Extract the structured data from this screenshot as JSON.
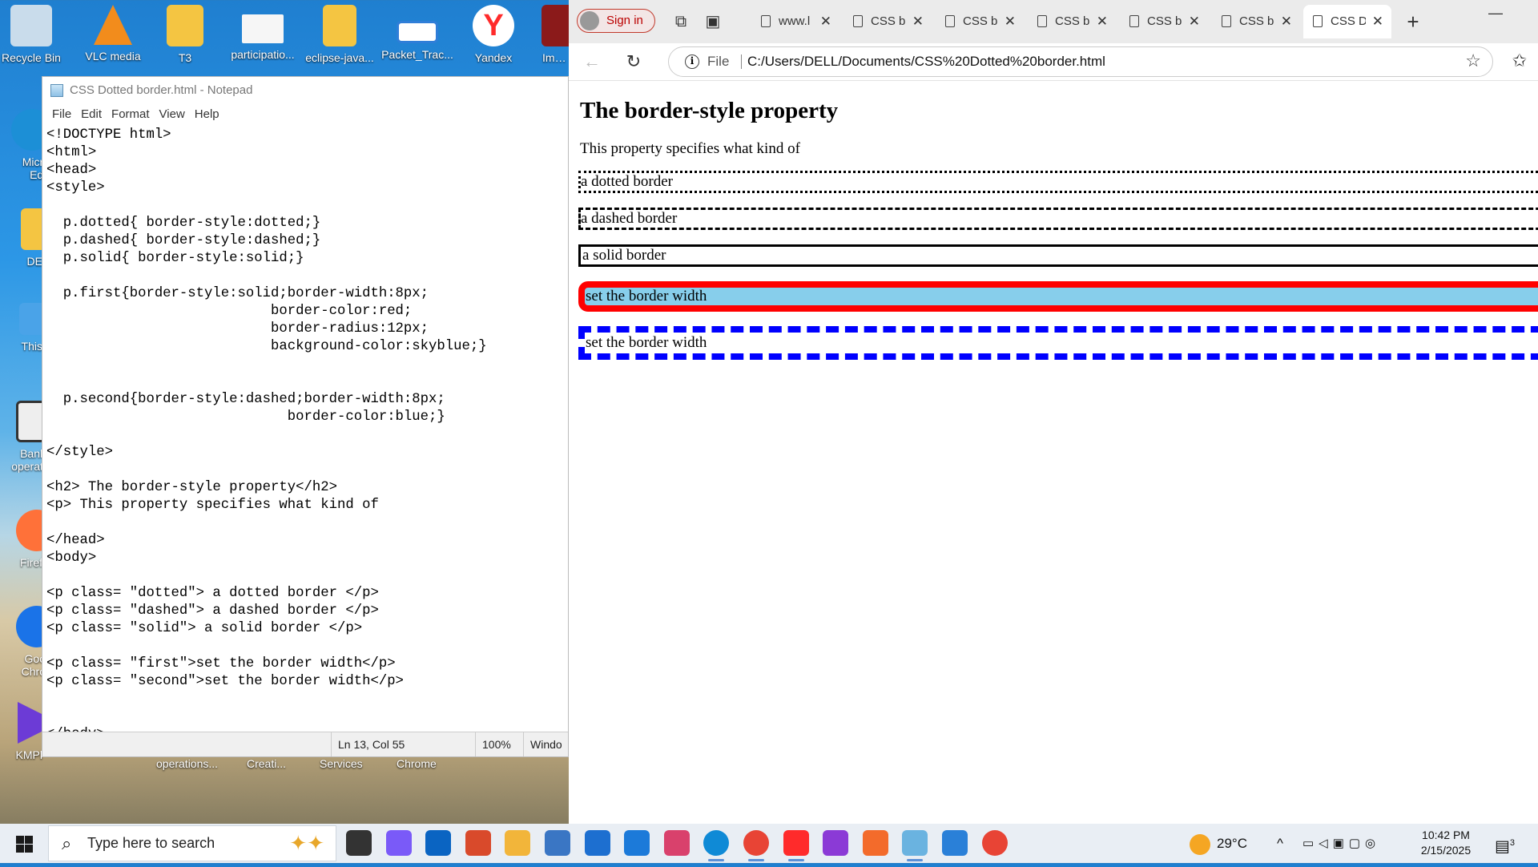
{
  "desktop": {
    "top_icons": [
      {
        "label": "Recycle Bin",
        "color": "#b9d4e8"
      },
      {
        "label": "VLC media",
        "color": "#f28c1c"
      },
      {
        "label": "T3",
        "color": "#f4c542"
      },
      {
        "label": "participatio...",
        "color": "#f2f2f2"
      },
      {
        "label": "eclipse-java...",
        "color": "#f4c542"
      },
      {
        "label": "Packet_Trac...",
        "color": "#2f7ed8"
      },
      {
        "label": "Yandex",
        "color": "#ffffff"
      },
      {
        "label": "Impo",
        "color": "#8b1a1a"
      }
    ],
    "left_icons": [
      {
        "label": "Micro Edg",
        "color": "#1c8fd6"
      },
      {
        "label": "DE",
        "color": "#f4c542"
      },
      {
        "label": "This",
        "color": "#4aa3e8"
      },
      {
        "label": "Bank operati",
        "color": "#eeeeee"
      },
      {
        "label": "Firef",
        "color": "#ff7139"
      },
      {
        "label": "Goo Chro",
        "color": "#1a73e8"
      },
      {
        "label": "KMPl",
        "color": "#6c3bd6"
      }
    ],
    "bottom_labels": [
      "operations...",
      "Creati...",
      "Services",
      "Chrome"
    ]
  },
  "notepad": {
    "title": "CSS Dotted border.html - Notepad",
    "menu": [
      "File",
      "Edit",
      "Format",
      "View",
      "Help"
    ],
    "code": "<!DOCTYPE html>\n<html>\n<head>\n<style>\n\n  p.dotted{ border-style:dotted;}\n  p.dashed{ border-style:dashed;}\n  p.solid{ border-style:solid;}\n\n  p.first{border-style:solid;border-width:8px;\n                           border-color:red;\n                           border-radius:12px;\n                           background-color:skyblue;}\n\n\n  p.second{border-style:dashed;border-width:8px;\n                             border-color:blue;}\n\n</style>\n\n<h2> The border-style property</h2>\n<p> This property specifies what kind of\n\n</head>\n<body>\n\n<p class= \"dotted\"> a dotted border </p>\n<p class= \"dashed\"> a dashed border </p>\n<p class= \"solid\"> a solid border </p>\n\n<p class= \"first\">set the border width</p>\n<p class= \"second\">set the border width</p>\n\n\n</body>",
    "status": {
      "position": "Ln 13, Col 55",
      "zoom": "100%",
      "eol": "Windo"
    }
  },
  "browser": {
    "signin": "Sign in",
    "tabs": [
      {
        "title": "www.l",
        "active": false
      },
      {
        "title": "CSS b",
        "active": false
      },
      {
        "title": "CSS b",
        "active": false
      },
      {
        "title": "CSS b",
        "active": false
      },
      {
        "title": "CSS b",
        "active": false
      },
      {
        "title": "CSS b",
        "active": false
      },
      {
        "title": "CSS D",
        "active": true
      }
    ],
    "new_tab": "+",
    "minimize": "—",
    "address": {
      "scheme": "File",
      "url": "C:/Users/DELL/Documents/CSS%20Dotted%20border.html"
    },
    "page": {
      "heading": "The border-style property",
      "intro": "This property specifies what kind of",
      "dotted": "a dotted border",
      "dashed": "a dashed border",
      "solid": "a solid border",
      "first": "set the border width",
      "second": "set the border width"
    }
  },
  "taskbar": {
    "search_placeholder": "Type here to search",
    "weather": "29°C",
    "time": "10:42 PM",
    "date": "2/15/2025",
    "notification_count": "3",
    "apps": [
      {
        "name": "task-view",
        "color": "#333333"
      },
      {
        "name": "copilot",
        "color": "#7a5af8"
      },
      {
        "name": "outlook",
        "color": "#0a64c2"
      },
      {
        "name": "app-red",
        "color": "#d94a2b"
      },
      {
        "name": "file-explorer",
        "color": "#f2b53a"
      },
      {
        "name": "calculator",
        "color": "#3a76c4"
      },
      {
        "name": "mail",
        "color": "#1d6fd0"
      },
      {
        "name": "azure",
        "color": "#1c7ad9"
      },
      {
        "name": "snipping-tool",
        "color": "#d9416c"
      },
      {
        "name": "edge",
        "color": "#0f8ad6",
        "running": true
      },
      {
        "name": "chrome",
        "color": "#e84435",
        "running": true
      },
      {
        "name": "yandex",
        "color": "#ff2b2b",
        "running": true
      },
      {
        "name": "app-mask",
        "color": "#8b3ad6"
      },
      {
        "name": "xampp",
        "color": "#f36b2b"
      },
      {
        "name": "notepad",
        "color": "#6ab3e0",
        "running": true
      },
      {
        "name": "paint",
        "color": "#2a80d8"
      },
      {
        "name": "chrome-2",
        "color": "#e84435"
      }
    ]
  }
}
